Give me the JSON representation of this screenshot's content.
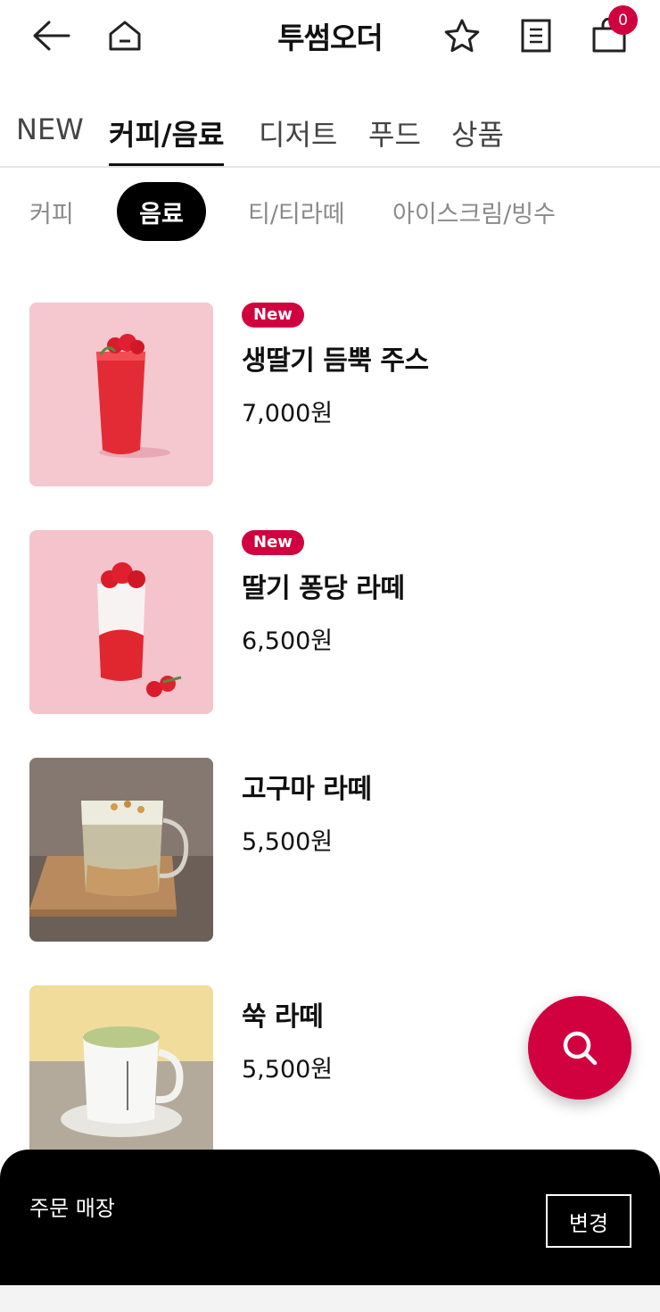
{
  "header": {
    "title": "투썸오더",
    "cart_count": "0",
    "icons": [
      "back-arrow-icon",
      "home-icon",
      "star-icon",
      "receipt-icon",
      "cart-bag-icon"
    ]
  },
  "main_tabs": [
    {
      "label": "NEW",
      "active": false
    },
    {
      "label": "커피/음료",
      "active": true
    },
    {
      "label": "디저트",
      "active": false
    },
    {
      "label": "푸드",
      "active": false
    },
    {
      "label": "상품",
      "active": false
    }
  ],
  "sub_tabs": [
    {
      "label": "커피",
      "active": false
    },
    {
      "label": "음료",
      "active": true
    },
    {
      "label": "티/티라떼",
      "active": false
    },
    {
      "label": "아이스크림/빙수",
      "active": false
    }
  ],
  "products": [
    {
      "badge": "New",
      "name": "생딸기 듬뿍 주스",
      "price": "7,000원"
    },
    {
      "badge": "New",
      "name": "딸기 퐁당 라떼",
      "price": "6,500원"
    },
    {
      "badge": "",
      "name": "고구마 라떼",
      "price": "5,500원"
    },
    {
      "badge": "",
      "name": "쑥 라떼",
      "price": "5,500원"
    }
  ],
  "store": {
    "label": "주문 매장",
    "change_label": "변경"
  },
  "colors": {
    "accent": "#d1003f",
    "sheet": "#000000"
  },
  "fab_icon": "search-icon"
}
